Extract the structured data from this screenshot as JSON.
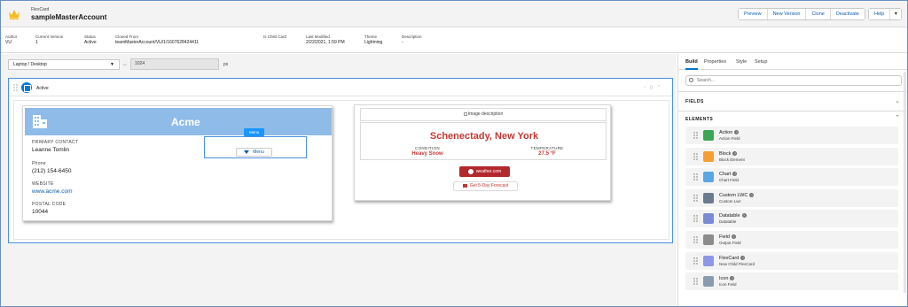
{
  "header": {
    "app_sub": "FlexCard",
    "title": "sampleMasterAccount",
    "buttons": [
      "Preview",
      "New Version",
      "Clone",
      "Deactivate"
    ],
    "help": "Help",
    "crown_color": "#f4bc25"
  },
  "meta": [
    {
      "label": "Author",
      "value": "VU"
    },
    {
      "label": "Current Version",
      "value": "1"
    },
    {
      "label": "Status",
      "value": "Active"
    },
    {
      "label": "Cloned From",
      "value": "teamMasterAccount/VU/1/1607628424411"
    },
    {
      "label": "Is Child Card",
      "value": ""
    },
    {
      "label": "Last Modified",
      "value": "2/22/2021, 1:59 PM"
    },
    {
      "label": "Theme",
      "value": "Lightning"
    },
    {
      "label": "Description",
      "value": "-"
    }
  ],
  "toolbar": {
    "device": "Laptop / Desktop",
    "width_value": "1024",
    "unit": "px"
  },
  "canvas": {
    "state_label": "Active"
  },
  "card1": {
    "title": "Acme",
    "fields": [
      {
        "label": "PRIMARY CONTACT",
        "value": "Leanne Tomlin"
      },
      {
        "label": "Phone",
        "value": "(212) 154-6450"
      },
      {
        "label": "WEBSITE",
        "value": "www.acme.com"
      },
      {
        "label": "POSTAL CODE",
        "value": "10044"
      }
    ],
    "menu_tag": "Menu",
    "menu_button": "Menu"
  },
  "card2": {
    "image_alt": "Image description",
    "city": "Schenectady, New York",
    "condition_label": "CONDITION",
    "condition_value": "Heavy Snow",
    "temperature_label": "TEMPERATURE",
    "temperature_value": "27.5 °F",
    "weather_button": "weather.com",
    "forecast_button": "Get 5-Day Forecast"
  },
  "right_panel": {
    "tabs": [
      "Build",
      "Properties",
      "Style",
      "Setup"
    ],
    "active_tab": "Build",
    "search_placeholder": "Search...",
    "fields_heading": "FIELDS",
    "elements_heading": "ELEMENTS",
    "elements": [
      {
        "title": "Action",
        "sub": "Action Field",
        "icon": "action-icon",
        "color": "#3ba755"
      },
      {
        "title": "Block",
        "sub": "Block Element",
        "icon": "block-icon",
        "color": "#f59f33"
      },
      {
        "title": "Chart",
        "sub": "Chart Field",
        "icon": "chart-icon",
        "color": "#5aa7e6"
      },
      {
        "title": "Custom LWC",
        "sub": "Custom Lwc",
        "icon": "custom-lwc-icon",
        "color": "#6b7a8f"
      },
      {
        "title": "Datatable",
        "sub": "Datatable",
        "icon": "datatable-icon",
        "color": "#7b8ad6"
      },
      {
        "title": "Field",
        "sub": "Output Field",
        "icon": "field-icon",
        "color": "#8c8c8c"
      },
      {
        "title": "FlexCard",
        "sub": "New Child FlexCard",
        "icon": "flexcard-icon",
        "color": "#8e96e6"
      },
      {
        "title": "Icon",
        "sub": "Icon Field",
        "icon": "icon-field-icon",
        "color": "#8a9bb0"
      }
    ]
  }
}
